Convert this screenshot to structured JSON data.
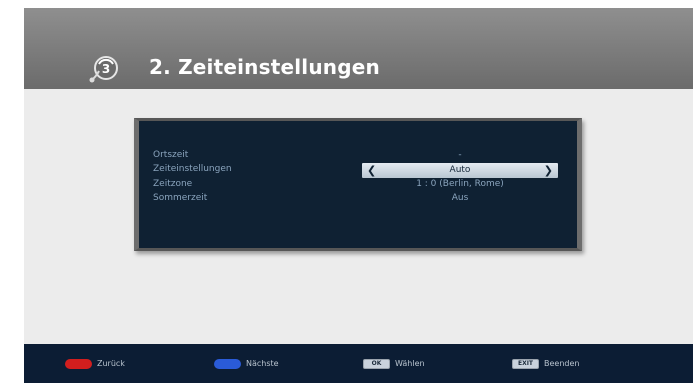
{
  "header": {
    "title": "2. Zeiteinstellungen",
    "icon": "wizard-step-icon"
  },
  "settings": {
    "rows": [
      {
        "label": "Ortszeit",
        "value": "-"
      },
      {
        "label": "Zeiteinstellungen",
        "value": "Auto"
      },
      {
        "label": "Zeitzone",
        "value": "1 : 0 (Berlin, Rome)"
      },
      {
        "label": "Sommerzeit",
        "value": "Aus"
      }
    ],
    "selected_index": 1
  },
  "footer": {
    "hints": [
      {
        "key": "red",
        "label": "Zurück",
        "color": "#d21e1e"
      },
      {
        "key": "blue",
        "label": "Nächste",
        "color": "#2a5bd8"
      },
      {
        "key": "OK",
        "label": "Wählen",
        "color": "#c9d2dc"
      },
      {
        "key": "EXIT",
        "label": "Beenden",
        "color": "#c9d2dc"
      }
    ]
  },
  "colors": {
    "panel_bg": "#0f2133",
    "footer_bg": "#0c1d34",
    "header_bg": "#7d7d7d",
    "selected_row": "#cfd9e3"
  }
}
